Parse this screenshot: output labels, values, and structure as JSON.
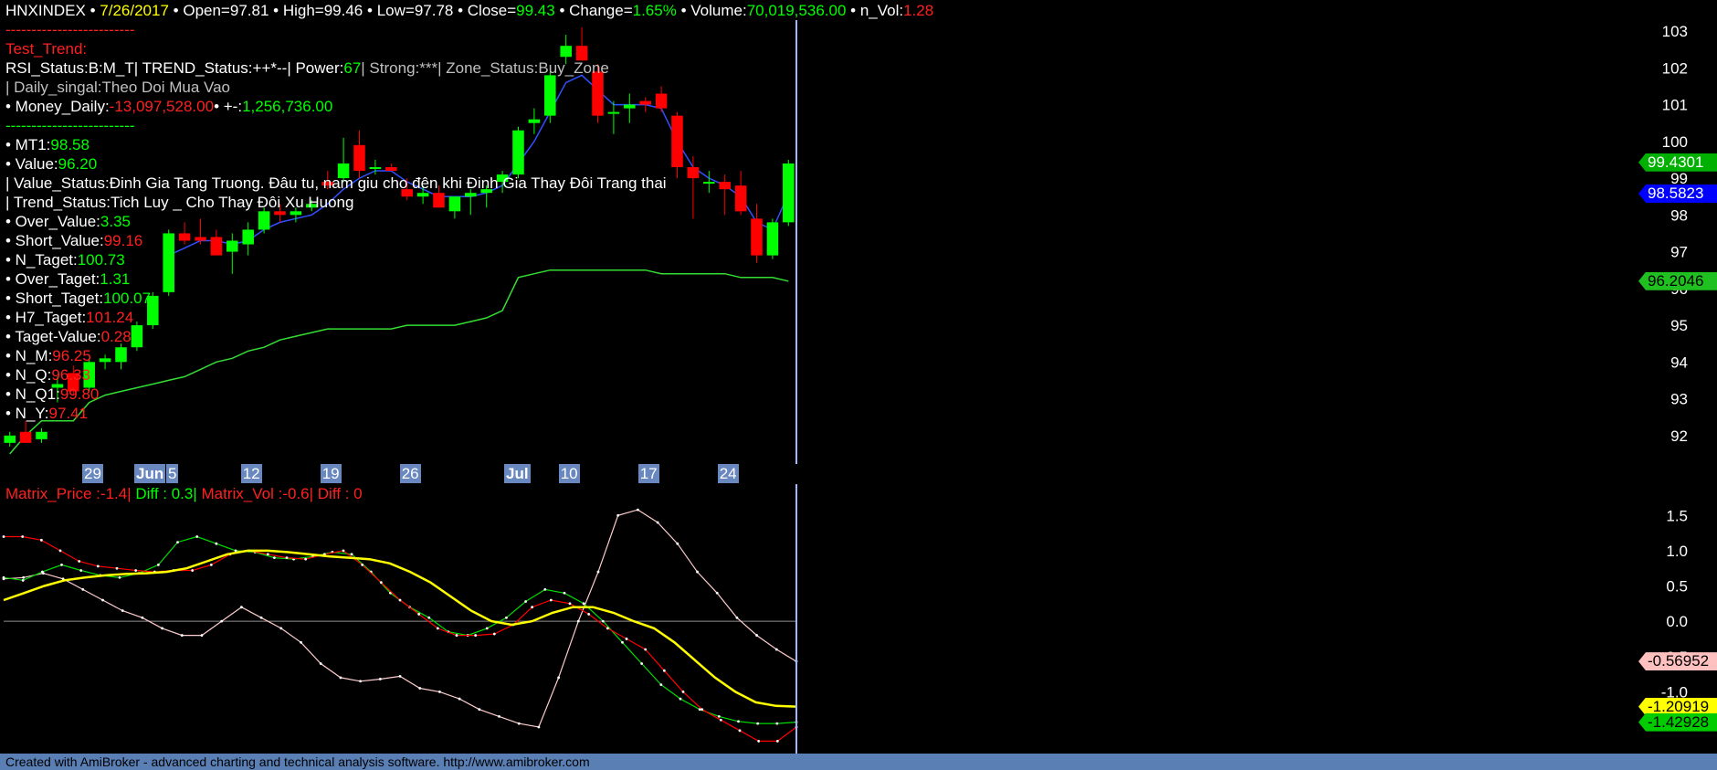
{
  "header": {
    "ticker": "HNXINDEX",
    "bullet": "•",
    "date": "7/26/2017",
    "open_label": "Open=",
    "open": "97.81",
    "high_label": "High=",
    "high": "99.46",
    "low_label": "Low=",
    "low": "97.78",
    "close_label": "Close=",
    "close": "99.43",
    "change_label": "Change=",
    "change": "1.65%",
    "volume_label": "Volume:",
    "volume": "70,019,536.00",
    "nvol_label": "n_Vol:",
    "nvol": "1.28"
  },
  "panel": {
    "sep1": "-------------------------",
    "test_trend": "Test_Trend:",
    "rsi_line_a": "RSI_Status:B:M_T| TREND_Status:++*--| Power:",
    "power": "67",
    "rsi_line_b": "| Strong:***| Zone_Status:Buy_Zone",
    "daily_signal": "| Daily_singal:Theo Doi Mua Vao",
    "money_label": "• Money_Daily:",
    "money_daily": "-13,097,528.00",
    "money_sep": "• +-:",
    "money_change": "1,256,736.00",
    "sep2": "-------------------------",
    "mt1_label": "• MT1:",
    "mt1": "98.58",
    "value_label": "• Value:",
    "value": "96.20",
    "value_status": "| Value_Status:Đinh Gia Tang Truong. Đâu tu, nam giu cho đên khi Đinh Gia Thay Đôi Trang thai",
    "trend_status": "| Trend_Status:Tich Luy _ Cho Thay Đôi Xu Huong",
    "over_value_label": "• Over_Value:",
    "over_value": "3.35",
    "short_value_label": "• Short_Value:",
    "short_value": "99.16",
    "n_taget_label": "• N_Taget:",
    "n_taget": "100.73",
    "over_taget_label": "• Over_Taget:",
    "over_taget": "1.31",
    "short_taget_label": "• Short_Taget:",
    "short_taget": "100.07",
    "h7_taget_label": "• H7_Taget:",
    "h7_taget": "101.24",
    "taget_value_label": "• Taget-Value:",
    "taget_value": "0.28",
    "n_m_label": "• N_M:",
    "n_m": "96.25",
    "n_q_label": "• N_Q:",
    "n_q": "96.33",
    "n_q1_label": "• N_Q1:",
    "n_q1": "99.80",
    "n_y_label": "• N_Y:",
    "n_y": "97.41"
  },
  "matrix": {
    "price_label": "Matrix_Price :-1.4|",
    "diff1_label": "Diff : 0.3|",
    "vol_label": "Matrix_Vol :-0.6|",
    "diff2_label": "Diff : 0"
  },
  "footer": {
    "text": "Created with AmiBroker - advanced charting and technical analysis software. http://www.amibroker.com"
  },
  "colors": {
    "up": "#00ff00",
    "down": "#ff0000",
    "bg": "#000000",
    "cursor": "#9fb7ff"
  },
  "chart_data": [
    {
      "type": "candlestick",
      "x_ticks": [
        "29",
        "Jun",
        "5",
        "12",
        "19",
        "26",
        "Jul",
        "10",
        "17",
        "24"
      ],
      "y_ticks": [
        "92",
        "93",
        "94",
        "95",
        "96",
        "97",
        "98",
        "99",
        "100",
        "101",
        "102",
        "103"
      ],
      "ylim": [
        91.3,
        103.3
      ],
      "candles": [
        {
          "o": 91.8,
          "h": 92.1,
          "l": 91.7,
          "c": 92.0
        },
        {
          "o": 92.1,
          "h": 92.4,
          "l": 91.8,
          "c": 91.8
        },
        {
          "o": 91.9,
          "h": 92.2,
          "l": 91.8,
          "c": 92.1
        },
        {
          "o": 93.3,
          "h": 93.6,
          "l": 92.9,
          "c": 93.4
        },
        {
          "o": 93.7,
          "h": 93.9,
          "l": 93.1,
          "c": 93.2
        },
        {
          "o": 93.3,
          "h": 94.1,
          "l": 93.2,
          "c": 94.0
        },
        {
          "o": 94.0,
          "h": 94.2,
          "l": 93.8,
          "c": 94.1
        },
        {
          "o": 94.0,
          "h": 94.5,
          "l": 93.8,
          "c": 94.4
        },
        {
          "o": 94.4,
          "h": 95.1,
          "l": 94.3,
          "c": 95.0
        },
        {
          "o": 95.0,
          "h": 95.9,
          "l": 94.9,
          "c": 95.8
        },
        {
          "o": 95.9,
          "h": 97.6,
          "l": 95.8,
          "c": 97.5
        },
        {
          "o": 97.5,
          "h": 97.8,
          "l": 97.2,
          "c": 97.3
        },
        {
          "o": 97.4,
          "h": 97.9,
          "l": 97.2,
          "c": 97.3
        },
        {
          "o": 97.4,
          "h": 97.6,
          "l": 96.9,
          "c": 96.9
        },
        {
          "o": 97.0,
          "h": 97.5,
          "l": 96.4,
          "c": 97.3
        },
        {
          "o": 97.2,
          "h": 97.8,
          "l": 96.9,
          "c": 97.6
        },
        {
          "o": 97.6,
          "h": 98.2,
          "l": 97.5,
          "c": 98.1
        },
        {
          "o": 98.1,
          "h": 98.3,
          "l": 97.8,
          "c": 98.0
        },
        {
          "o": 98.0,
          "h": 98.2,
          "l": 97.8,
          "c": 98.1
        },
        {
          "o": 98.2,
          "h": 98.4,
          "l": 98.1,
          "c": 98.3
        },
        {
          "o": 98.9,
          "h": 99.2,
          "l": 98.7,
          "c": 98.8
        },
        {
          "o": 99.0,
          "h": 100.1,
          "l": 98.9,
          "c": 99.4
        },
        {
          "o": 99.9,
          "h": 100.3,
          "l": 99.0,
          "c": 99.2
        },
        {
          "o": 99.3,
          "h": 99.5,
          "l": 99.1,
          "c": 99.3
        },
        {
          "o": 99.3,
          "h": 99.4,
          "l": 99.2,
          "c": 99.2
        },
        {
          "o": 98.7,
          "h": 99.0,
          "l": 98.4,
          "c": 98.5
        },
        {
          "o": 98.5,
          "h": 98.8,
          "l": 98.3,
          "c": 98.6
        },
        {
          "o": 98.6,
          "h": 98.8,
          "l": 98.3,
          "c": 98.2
        },
        {
          "o": 98.1,
          "h": 98.5,
          "l": 97.9,
          "c": 98.5
        },
        {
          "o": 98.5,
          "h": 98.7,
          "l": 98.0,
          "c": 98.6
        },
        {
          "o": 98.6,
          "h": 98.8,
          "l": 98.2,
          "c": 98.7
        },
        {
          "o": 98.9,
          "h": 99.2,
          "l": 98.6,
          "c": 99.1
        },
        {
          "o": 99.1,
          "h": 100.4,
          "l": 99.0,
          "c": 100.3
        },
        {
          "o": 100.5,
          "h": 100.9,
          "l": 100.2,
          "c": 100.6
        },
        {
          "o": 100.7,
          "h": 101.9,
          "l": 100.5,
          "c": 101.8
        },
        {
          "o": 102.3,
          "h": 102.9,
          "l": 102.1,
          "c": 102.6
        },
        {
          "o": 102.6,
          "h": 103.1,
          "l": 102.2,
          "c": 102.2
        },
        {
          "o": 101.9,
          "h": 102.1,
          "l": 100.5,
          "c": 100.7
        },
        {
          "o": 100.8,
          "h": 101.1,
          "l": 100.2,
          "c": 100.8
        },
        {
          "o": 100.9,
          "h": 101.3,
          "l": 100.5,
          "c": 101.0
        },
        {
          "o": 101.1,
          "h": 101.2,
          "l": 100.8,
          "c": 101.0
        },
        {
          "o": 101.3,
          "h": 101.5,
          "l": 100.8,
          "c": 100.9
        },
        {
          "o": 100.7,
          "h": 100.8,
          "l": 99.0,
          "c": 99.3
        },
        {
          "o": 99.3,
          "h": 99.6,
          "l": 97.9,
          "c": 99.0
        },
        {
          "o": 98.9,
          "h": 99.2,
          "l": 98.6,
          "c": 98.9
        },
        {
          "o": 98.9,
          "h": 99.1,
          "l": 98.0,
          "c": 98.7
        },
        {
          "o": 98.8,
          "h": 99.2,
          "l": 98.0,
          "c": 98.1
        },
        {
          "o": 97.9,
          "h": 98.3,
          "l": 96.7,
          "c": 96.9
        },
        {
          "o": 96.9,
          "h": 97.9,
          "l": 96.8,
          "c": 97.8
        },
        {
          "o": 97.8,
          "h": 99.5,
          "l": 97.7,
          "c": 99.4
        }
      ],
      "mt1_line": [
        null,
        null,
        null,
        null,
        null,
        null,
        null,
        null,
        null,
        null,
        96.9,
        97.1,
        97.3,
        97.3,
        97.2,
        97.3,
        97.6,
        97.8,
        97.9,
        98.0,
        98.3,
        98.7,
        99.0,
        99.2,
        99.2,
        98.9,
        98.7,
        98.5,
        98.5,
        98.5,
        98.6,
        98.8,
        99.4,
        100.0,
        100.8,
        101.6,
        101.8,
        101.4,
        101.0,
        101.0,
        101.0,
        100.9,
        100.0,
        99.3,
        99.0,
        98.8,
        98.5,
        97.8,
        97.6,
        98.58
      ],
      "value_line": [
        91.5,
        92.0,
        92.4,
        92.4,
        92.4,
        92.9,
        93.1,
        93.2,
        93.3,
        93.4,
        93.5,
        93.6,
        93.8,
        94.0,
        94.1,
        94.3,
        94.4,
        94.6,
        94.7,
        94.8,
        94.9,
        94.9,
        94.9,
        94.9,
        94.9,
        95.0,
        95.0,
        95.0,
        95.0,
        95.1,
        95.2,
        95.4,
        96.3,
        96.4,
        96.5,
        96.5,
        96.5,
        96.5,
        96.5,
        96.5,
        96.5,
        96.4,
        96.4,
        96.4,
        96.4,
        96.4,
        96.3,
        96.3,
        96.3,
        96.2
      ],
      "price_tags": [
        {
          "text": "99.4301",
          "value": 99.43,
          "color": "#00b000",
          "text_color": "#ffffff"
        },
        {
          "text": "98.5823",
          "value": 98.58,
          "color": "#0000ff",
          "text_color": "#ffffff"
        },
        {
          "text": "96.2046",
          "value": 96.2,
          "color": "#20c020",
          "text_color": "#000000"
        }
      ]
    },
    {
      "type": "line",
      "y_ticks": [
        "1.5",
        "1.0",
        "0.5",
        "0.0",
        "-0.5",
        "-1.0"
      ],
      "ylim": [
        -1.85,
        1.75
      ],
      "series": [
        {
          "name": "Matrix_Price",
          "color": "#ff0000",
          "values": [
            1.2,
            1.2,
            1.15,
            1.0,
            0.85,
            0.78,
            0.75,
            0.72,
            0.7,
            0.72,
            0.72,
            0.8,
            0.95,
            1.0,
            0.95,
            0.9,
            0.88,
            0.95,
            1.0,
            0.8,
            0.55,
            0.3,
            0.1,
            -0.1,
            -0.2,
            -0.2,
            -0.18,
            -0.05,
            0.2,
            0.3,
            0.25,
            0.1,
            -0.1,
            -0.25,
            -0.4,
            -0.7,
            -1.0,
            -1.25,
            -1.4,
            -1.55,
            -1.7,
            -1.7,
            -1.5
          ]
        },
        {
          "name": "Diff",
          "color": "#00dd00",
          "values": [
            0.62,
            0.58,
            0.7,
            0.8,
            0.72,
            0.65,
            0.62,
            0.68,
            0.8,
            1.12,
            1.2,
            1.1,
            1.0,
            0.98,
            0.9,
            0.88,
            0.92,
            0.98,
            0.95,
            0.7,
            0.4,
            0.2,
            0.05,
            -0.15,
            -0.2,
            -0.1,
            0.05,
            0.28,
            0.45,
            0.4,
            0.25,
            0.0,
            -0.3,
            -0.6,
            -0.9,
            -1.1,
            -1.25,
            -1.35,
            -1.42,
            -1.45,
            -1.45,
            -1.43
          ]
        },
        {
          "name": "Matrix_Vol",
          "color": "#ffcccc",
          "values": [
            0.6,
            0.62,
            0.68,
            0.6,
            0.45,
            0.3,
            0.15,
            0.05,
            -0.1,
            -0.2,
            -0.2,
            0.0,
            0.2,
            0.05,
            -0.1,
            -0.3,
            -0.6,
            -0.8,
            -0.85,
            -0.82,
            -0.78,
            -0.95,
            -1.0,
            -1.1,
            -1.25,
            -1.35,
            -1.45,
            -1.5,
            -0.8,
            0.0,
            0.7,
            1.5,
            1.58,
            1.4,
            1.1,
            0.7,
            0.4,
            0.05,
            -0.2,
            -0.4,
            -0.57
          ]
        },
        {
          "name": "Matrix_Price_smooth",
          "color": "#ffff00",
          "values": [
            0.3,
            0.4,
            0.5,
            0.58,
            0.62,
            0.65,
            0.67,
            0.68,
            0.7,
            0.75,
            0.85,
            0.95,
            1.0,
            1.0,
            0.98,
            0.95,
            0.92,
            0.9,
            0.88,
            0.82,
            0.7,
            0.55,
            0.35,
            0.15,
            0.0,
            -0.05,
            0.0,
            0.12,
            0.2,
            0.2,
            0.12,
            0.0,
            -0.1,
            -0.3,
            -0.55,
            -0.8,
            -1.0,
            -1.15,
            -1.2,
            -1.21
          ]
        }
      ],
      "value_tags": [
        {
          "text": "-0.56952",
          "value": -0.57,
          "color": "#ffc0c0",
          "text_color": "#000000"
        },
        {
          "text": "-1.20919",
          "value": -1.21,
          "color": "#ffff00",
          "text_color": "#000000"
        },
        {
          "text": "-1.42928",
          "value": -1.43,
          "color": "#00cc00",
          "text_color": "#000000"
        }
      ]
    }
  ]
}
